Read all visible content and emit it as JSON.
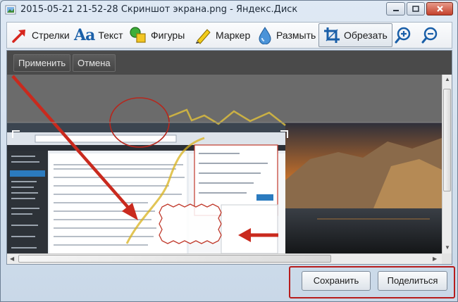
{
  "window": {
    "title": "2015-05-21 21-52-28 Скриншот экрана.png - Яндекс.Диск",
    "controls": {
      "minimize": "min",
      "maximize": "max",
      "close": "close"
    }
  },
  "toolbar": {
    "tools": [
      {
        "id": "arrow",
        "label": "Стрелки",
        "icon": "arrow-icon"
      },
      {
        "id": "text",
        "label": "Текст",
        "icon": "text-icon",
        "glyph": "Aa"
      },
      {
        "id": "shapes",
        "label": "Фигуры",
        "icon": "shapes-icon"
      },
      {
        "id": "marker",
        "label": "Маркер",
        "icon": "marker-icon"
      },
      {
        "id": "blur",
        "label": "Размыть",
        "icon": "blur-drop-icon"
      },
      {
        "id": "crop",
        "label": "Обрезать",
        "icon": "crop-icon",
        "active": true
      }
    ],
    "zoom_in": "zoom-in-icon",
    "zoom_out": "zoom-out-icon"
  },
  "crop_bar": {
    "apply_label": "Применить",
    "cancel_label": "Отмена"
  },
  "footer": {
    "save_label": "Сохранить",
    "share_label": "Поделиться"
  },
  "colors": {
    "accent_blue": "#1a5fa8",
    "annotation_red": "#c0392b",
    "highlight_border": "#b71c1c",
    "editor_dark": "#3d3d3d"
  }
}
